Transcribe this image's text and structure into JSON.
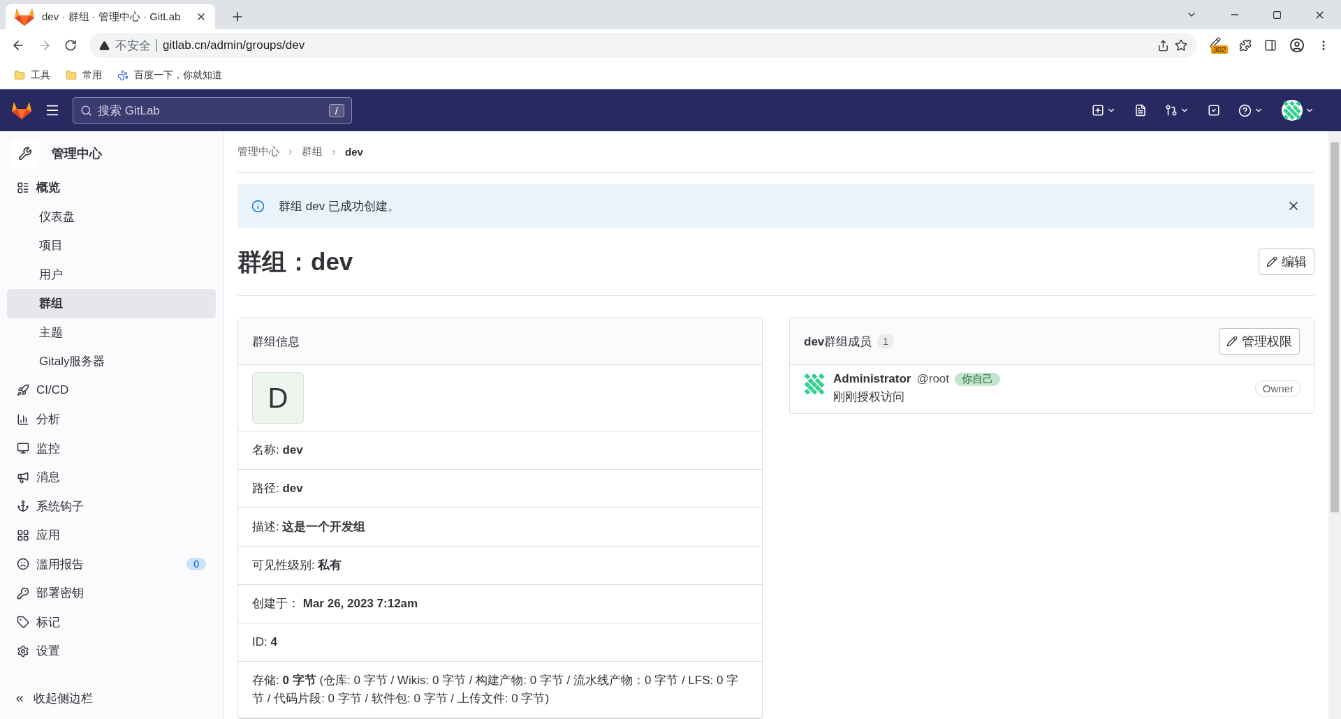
{
  "browser": {
    "tab_title": "dev · 群组 · 管理中心 · GitLab",
    "address_warning": "不安全",
    "url": "gitlab.cn/admin/groups/dev",
    "extension_badge": "302",
    "bookmarks": [
      "工具",
      "常用",
      "百度一下，你就知道"
    ]
  },
  "topbar": {
    "search_placeholder": "搜索 GitLab",
    "search_shortcut": "/"
  },
  "sidebar": {
    "title": "管理中心",
    "items": [
      {
        "label": "概览",
        "selected": false,
        "children": [
          {
            "label": "仪表盘",
            "selected": false
          },
          {
            "label": "项目",
            "selected": false
          },
          {
            "label": "用户",
            "selected": false
          },
          {
            "label": "群组",
            "selected": true
          },
          {
            "label": "主题",
            "selected": false
          },
          {
            "label": "Gitaly服务器",
            "selected": false
          }
        ]
      },
      {
        "label": "CI/CD",
        "selected": false
      },
      {
        "label": "分析",
        "selected": false
      },
      {
        "label": "监控",
        "selected": false
      },
      {
        "label": "消息",
        "selected": false
      },
      {
        "label": "系统钩子",
        "selected": false
      },
      {
        "label": "应用",
        "selected": false
      },
      {
        "label": "滥用报告",
        "selected": false,
        "badge": "0"
      },
      {
        "label": "部署密钥",
        "selected": false
      },
      {
        "label": "标记",
        "selected": false
      },
      {
        "label": "设置",
        "selected": false
      }
    ],
    "collapse": "收起侧边栏"
  },
  "breadcrumbs": [
    "管理中心",
    "群组",
    "dev"
  ],
  "alert": {
    "message": "群组 dev 已成功创建。"
  },
  "page_title": "群组：dev",
  "edit_button": "编辑",
  "group_info": {
    "title": "群组信息",
    "avatar_letter": "D",
    "rows": [
      {
        "label": "名称:",
        "value": "dev"
      },
      {
        "label": "路径:",
        "value": "dev"
      },
      {
        "label": "描述:",
        "value": "这是一个开发组"
      },
      {
        "label": "可见性级别:",
        "value": "私有"
      },
      {
        "label": "创建于：",
        "value": "Mar 26, 2023 7:12am"
      },
      {
        "label": "ID:",
        "value": "4"
      },
      {
        "label": "存储:",
        "value": "0 字节",
        "detail": "(仓库: 0 字节 / Wikis: 0 字节 / 构建产物: 0 字节 / 流水线产物：0 字节 / LFS: 0 字节 / 代码片段: 0 字节 / 软件包: 0 字节 / 上传文件: 0 字节)"
      }
    ]
  },
  "members": {
    "title": "**dev**群组成员",
    "count": "1",
    "manage_button": "管理权限",
    "items": [
      {
        "name": "Administrator",
        "username": "@root",
        "badge": "你自己",
        "access": "刚刚授权访问",
        "role": "Owner"
      }
    ]
  }
}
